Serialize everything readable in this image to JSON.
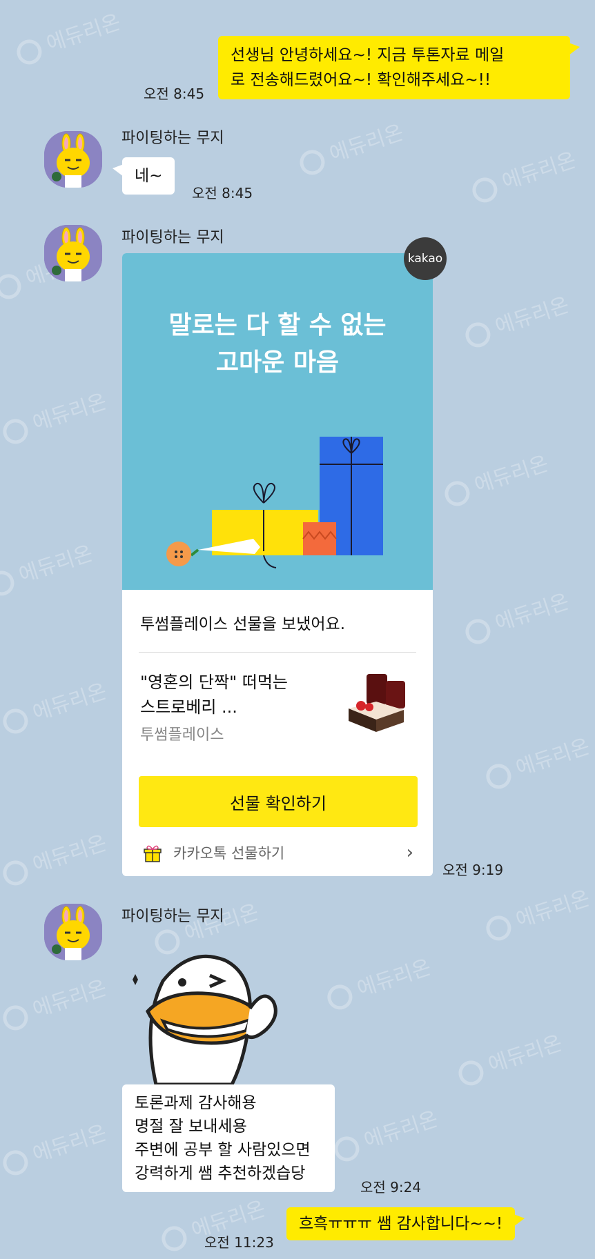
{
  "watermark": "에듀리온",
  "messages": {
    "m1": {
      "text_line1": "선생님 안녕하세요~! 지금 투톤자료 메일",
      "text_line2": "로 전송해드렸어요~! 확인해주세요~!!",
      "time": "오전 8:45"
    },
    "m2": {
      "sender": "파이팅하는 무지",
      "text": "네~",
      "time": "오전 8:45"
    },
    "m3": {
      "sender": "파이팅하는 무지",
      "badge": "kakao",
      "banner_line1": "말로는 다 할 수 없는",
      "banner_line2": "고마운 마음",
      "sent_text": "투썸플레이스 선물을 보냈어요.",
      "product_line1": "\"영혼의 단짝\" 떠먹는",
      "product_line2": "스트로베리 ...",
      "brand": "투썸플레이스",
      "button": "선물 확인하기",
      "footer": "카카오톡 선물하기",
      "time": "오전 9:19"
    },
    "m4": {
      "sender": "파이팅하는 무지",
      "lines": [
        "토론과제 감사해용",
        "명절 잘 보내세용",
        "주변에 공부 할 사람있으면",
        "강력하게 쌤 추천하겠습당"
      ],
      "time": "오전 9:24"
    },
    "m5": {
      "text": "흐흑ㅠㅠㅠ 쌤 감사합니다~~!",
      "time": "오전 11:23"
    }
  },
  "colors": {
    "background": "#bacee0",
    "my_bubble": "#ffeb00",
    "banner": "#6bbfd6",
    "gift_button": "#ffe812"
  }
}
